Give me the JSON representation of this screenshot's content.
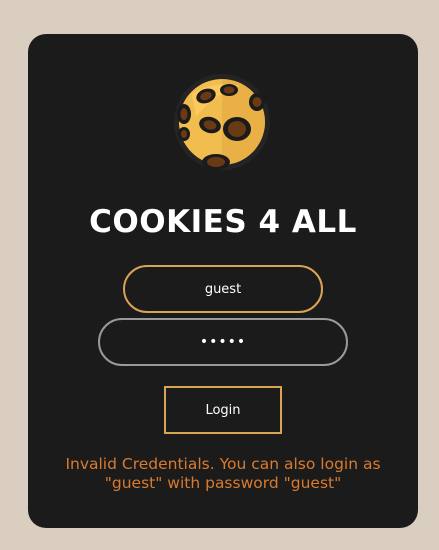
{
  "app": {
    "title": "COOKIES 4 ALL",
    "logo_icon": "cookie-icon"
  },
  "form": {
    "username": {
      "value": "guest",
      "placeholder": ""
    },
    "password": {
      "value": "guest",
      "placeholder": ""
    },
    "login_label": "Login"
  },
  "message": {
    "text": "Invalid Credentials. You can also login as \"guest\" with password \"guest\""
  },
  "colors": {
    "page_background": "#d9cebf",
    "card_background": "#1b1b1b",
    "accent": "#d9a453",
    "error": "#d97b2f",
    "password_border": "#9a9a9a"
  }
}
